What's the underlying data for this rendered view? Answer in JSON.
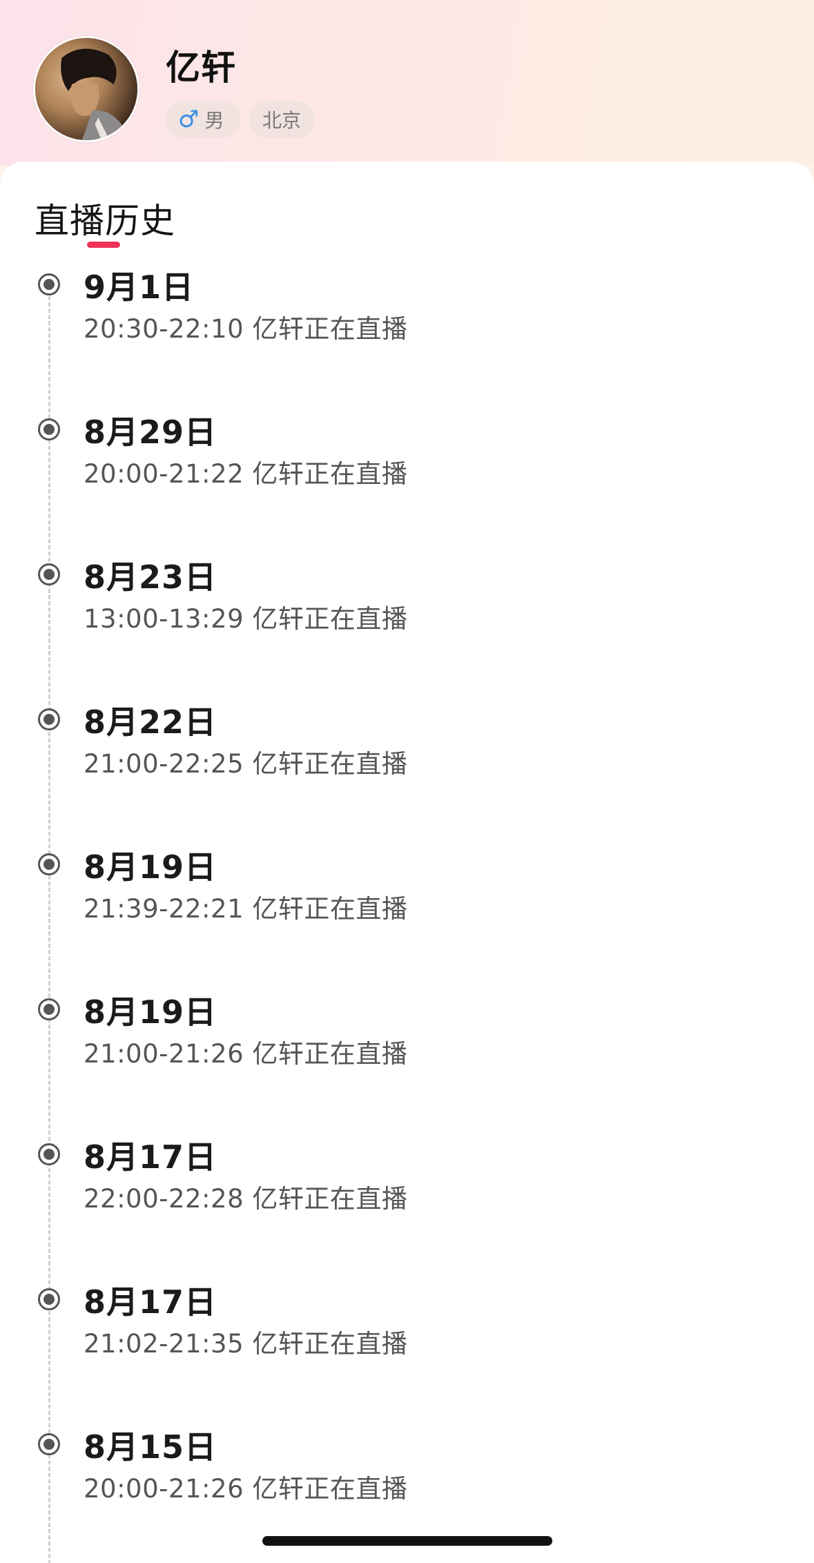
{
  "profile": {
    "name": "亿轩",
    "gender_label": "男",
    "gender_icon": "male-icon",
    "city": "北京"
  },
  "section": {
    "title": "直播历史",
    "accent_color": "#f0325a"
  },
  "history": [
    {
      "date": "9月1日",
      "desc": "20:30-22:10 亿轩正在直播"
    },
    {
      "date": "8月29日",
      "desc": "20:00-21:22 亿轩正在直播"
    },
    {
      "date": "8月23日",
      "desc": "13:00-13:29 亿轩正在直播"
    },
    {
      "date": "8月22日",
      "desc": "21:00-22:25 亿轩正在直播"
    },
    {
      "date": "8月19日",
      "desc": "21:39-22:21 亿轩正在直播"
    },
    {
      "date": "8月19日",
      "desc": "21:00-21:26 亿轩正在直播"
    },
    {
      "date": "8月17日",
      "desc": "22:00-22:28 亿轩正在直播"
    },
    {
      "date": "8月17日",
      "desc": "21:02-21:35 亿轩正在直播"
    },
    {
      "date": "8月15日",
      "desc": "20:00-21:26 亿轩正在直播"
    }
  ]
}
